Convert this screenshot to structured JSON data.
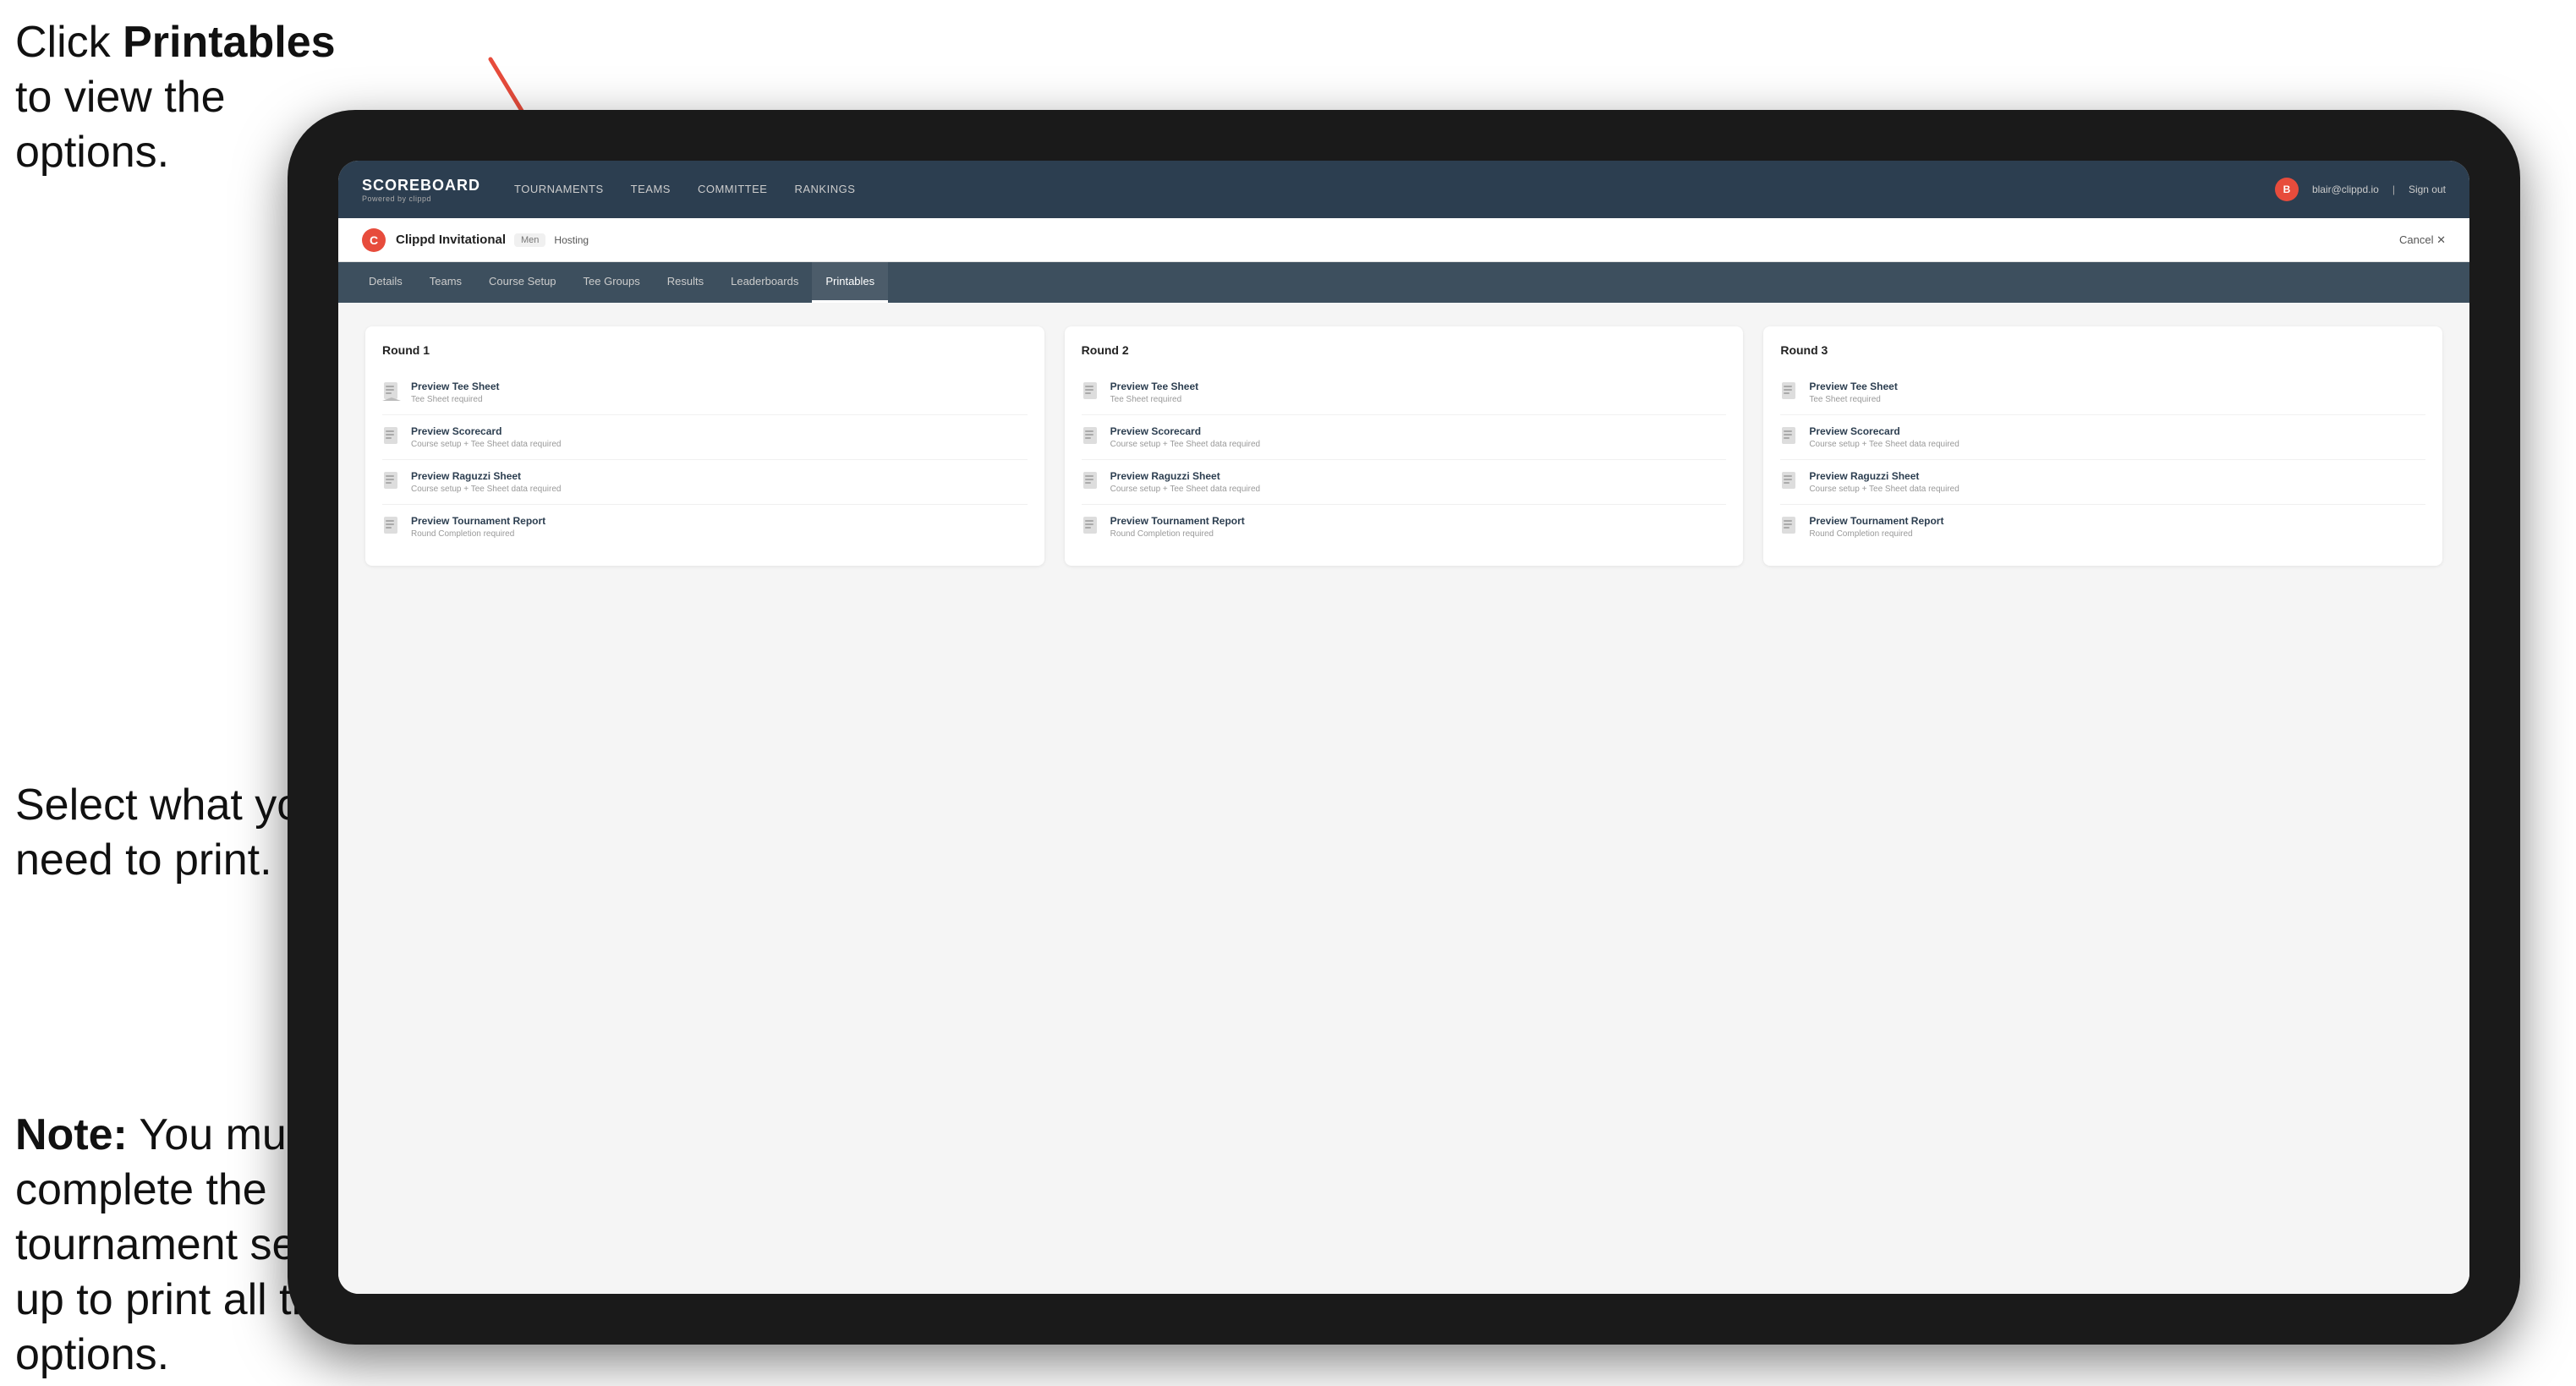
{
  "annotations": {
    "top": {
      "text_before": "Click ",
      "bold": "Printables",
      "text_after": " to view the options."
    },
    "middle": {
      "text": "Select what you need to print."
    },
    "bottom": {
      "bold_prefix": "Note:",
      "text": " You must complete the tournament set-up to print all the options."
    }
  },
  "nav": {
    "logo": {
      "title": "SCOREBOARD",
      "subtitle": "Powered by clippd"
    },
    "links": [
      {
        "label": "TOURNAMENTS",
        "active": false
      },
      {
        "label": "TEAMS",
        "active": false
      },
      {
        "label": "COMMITTEE",
        "active": false
      },
      {
        "label": "RANKINGS",
        "active": false
      }
    ],
    "user_email": "blair@clippd.io",
    "sign_out": "Sign out",
    "avatar_initials": "B"
  },
  "tournament": {
    "icon_letter": "C",
    "name": "Clippd Invitational",
    "badge": "Men",
    "status": "Hosting",
    "cancel": "Cancel ✕"
  },
  "tabs": [
    {
      "label": "Details",
      "active": false
    },
    {
      "label": "Teams",
      "active": false
    },
    {
      "label": "Course Setup",
      "active": false
    },
    {
      "label": "Tee Groups",
      "active": false
    },
    {
      "label": "Results",
      "active": false
    },
    {
      "label": "Leaderboards",
      "active": false
    },
    {
      "label": "Printables",
      "active": true
    }
  ],
  "rounds": [
    {
      "title": "Round 1",
      "items": [
        {
          "title": "Preview Tee Sheet",
          "subtitle": "Tee Sheet required"
        },
        {
          "title": "Preview Scorecard",
          "subtitle": "Course setup + Tee Sheet data required"
        },
        {
          "title": "Preview Raguzzi Sheet",
          "subtitle": "Course setup + Tee Sheet data required"
        },
        {
          "title": "Preview Tournament Report",
          "subtitle": "Round Completion required"
        }
      ]
    },
    {
      "title": "Round 2",
      "items": [
        {
          "title": "Preview Tee Sheet",
          "subtitle": "Tee Sheet required"
        },
        {
          "title": "Preview Scorecard",
          "subtitle": "Course setup + Tee Sheet data required"
        },
        {
          "title": "Preview Raguzzi Sheet",
          "subtitle": "Course setup + Tee Sheet data required"
        },
        {
          "title": "Preview Tournament Report",
          "subtitle": "Round Completion required"
        }
      ]
    },
    {
      "title": "Round 3",
      "items": [
        {
          "title": "Preview Tee Sheet",
          "subtitle": "Tee Sheet required"
        },
        {
          "title": "Preview Scorecard",
          "subtitle": "Course setup + Tee Sheet data required"
        },
        {
          "title": "Preview Raguzzi Sheet",
          "subtitle": "Course setup + Tee Sheet data required"
        },
        {
          "title": "Preview Tournament Report",
          "subtitle": "Round Completion required"
        }
      ]
    }
  ]
}
